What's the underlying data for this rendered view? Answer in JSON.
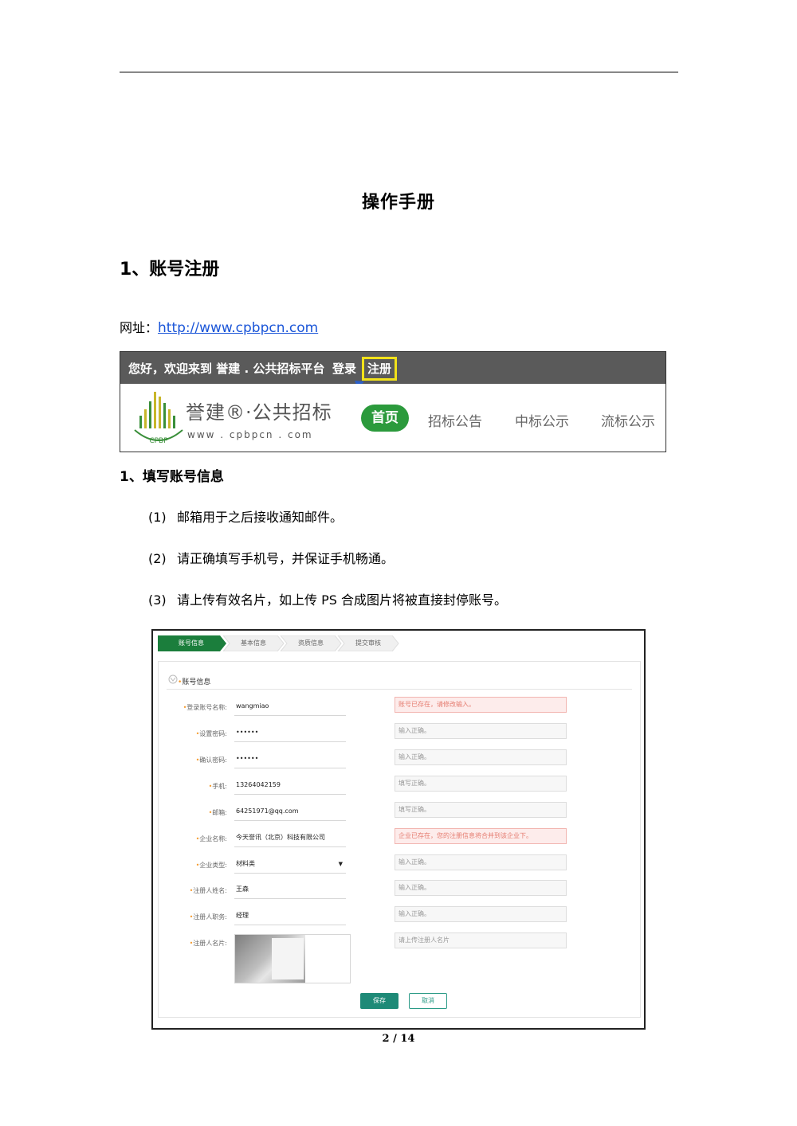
{
  "document": {
    "title": "操作手册",
    "section_heading": "1、账号注册",
    "url_label": "网址：",
    "url_link": "http://www.cpbpcn.com",
    "sub_heading": "1、填写账号信息",
    "steps": [
      {
        "num": "(1)",
        "text": "邮箱用于之后接收通知邮件。"
      },
      {
        "num": "(2)",
        "text": "请正确填写手机号，并保证手机畅通。"
      },
      {
        "num": "(3)",
        "text": "请上传有效名片，如上传 PS 合成图片将被直接封停账号。"
      }
    ],
    "page_number": "2 / 14"
  },
  "banner": {
    "welcome": "您好，欢迎来到 誉建 . 公共招标平台",
    "login": "登录",
    "register": "注册",
    "logo_name": "誉建®·公共招标",
    "logo_url": "www . cpbpcn . com",
    "logo_letters": "CPBP",
    "nav": [
      "首页",
      "招标公告",
      "中标公示",
      "流标公示"
    ],
    "highlight_color": "#f2e21a",
    "brand_color": "#2b9a3c"
  },
  "form": {
    "steps": [
      "账号信息",
      "基本信息",
      "资质信息",
      "提交审核"
    ],
    "panel_title": "账号信息",
    "rows": [
      {
        "label": "登录账号名称:",
        "value": "wangmiao",
        "tip": "账号已存在，请修改输入。",
        "error": true
      },
      {
        "label": "设置密码:",
        "value": "••••••",
        "tip": "输入正确。",
        "error": false
      },
      {
        "label": "确认密码:",
        "value": "••••••",
        "tip": "输入正确。",
        "error": false
      },
      {
        "label": "手机:",
        "value": "13264042159",
        "tip": "填写正确。",
        "error": false
      },
      {
        "label": "邮箱:",
        "value": "64251971@qq.com",
        "tip": "填写正确。",
        "error": false
      },
      {
        "label": "企业名称:",
        "value": "今天誉讯（北京）科技有限公司",
        "tip": "企业已存在，您的注册信息将合并到该企业下。",
        "error": true
      },
      {
        "label": "企业类型:",
        "value": "材料类",
        "tip": "输入正确。",
        "error": false
      },
      {
        "label": "注册人姓名:",
        "value": "王森",
        "tip": "输入正确。",
        "error": false
      },
      {
        "label": "注册人职务:",
        "value": "经理",
        "tip": "输入正确。",
        "error": false
      },
      {
        "label": "注册人名片:",
        "value": "",
        "tip": "请上传注册人名片",
        "error": false
      }
    ],
    "save": "保存",
    "cancel": "取消"
  }
}
